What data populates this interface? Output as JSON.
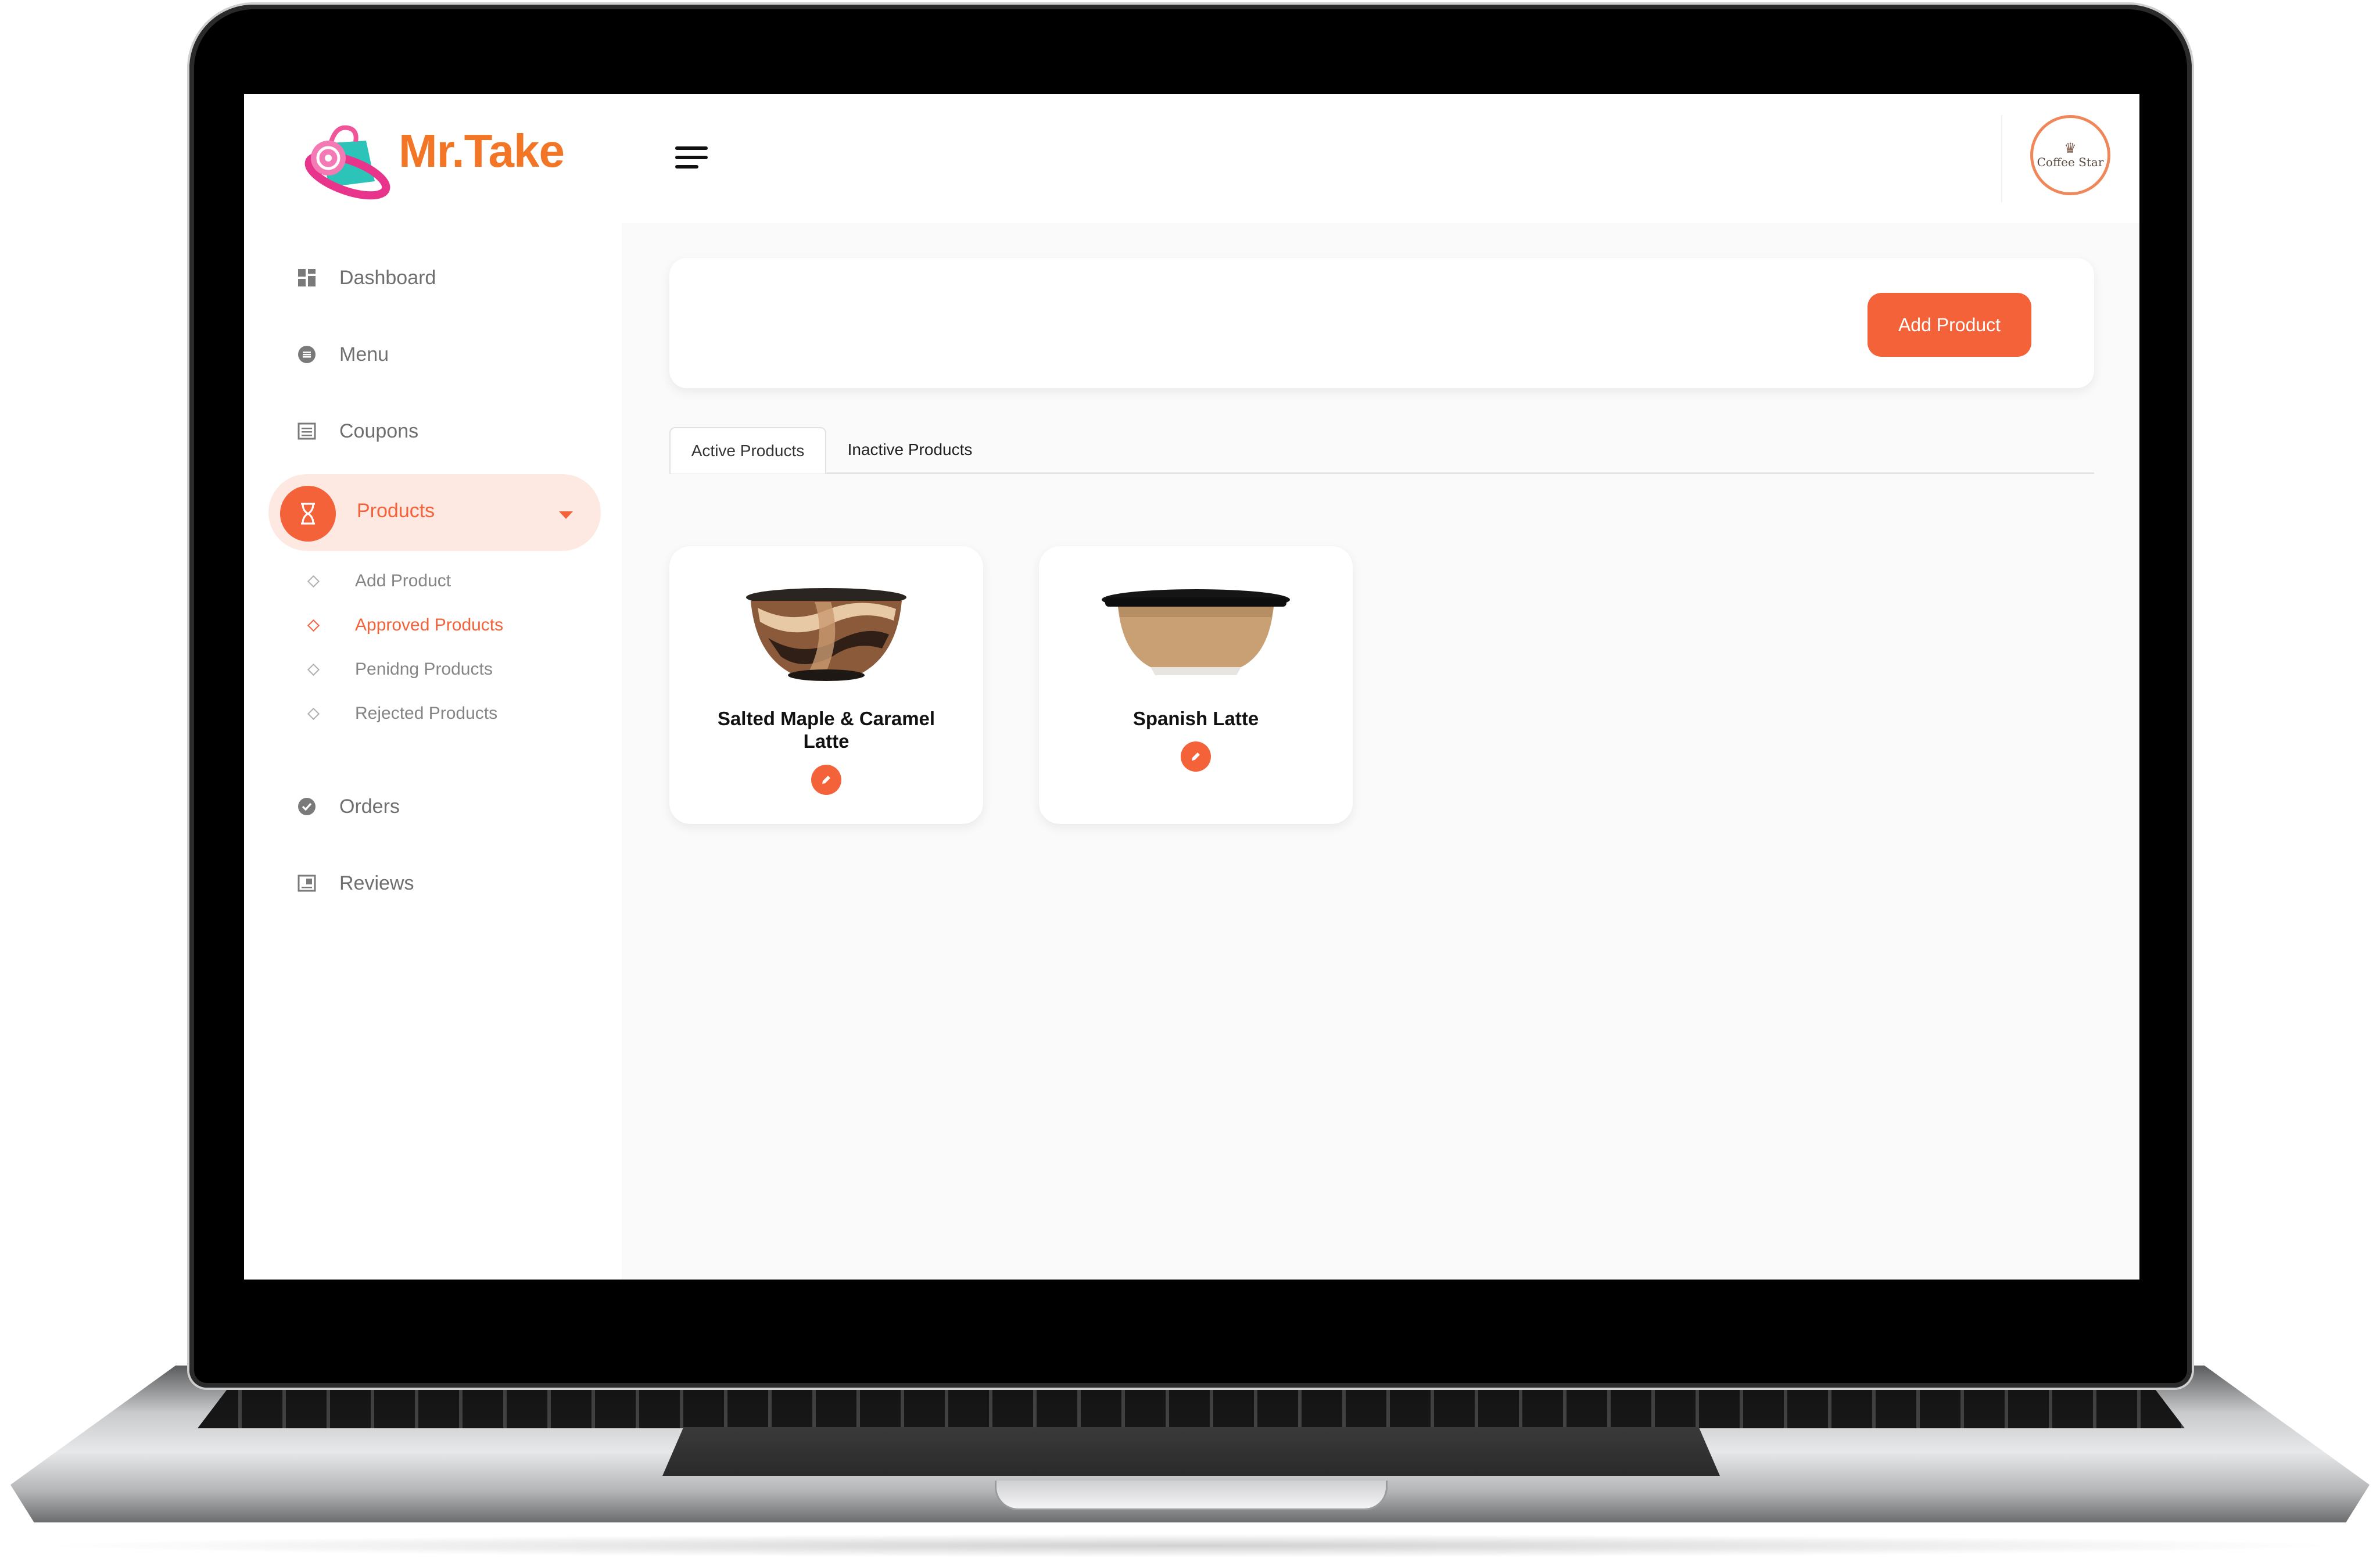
{
  "brand": {
    "name": "Mr.Take"
  },
  "sidebar": {
    "items": [
      {
        "label": "Dashboard",
        "icon": "dashboard-icon"
      },
      {
        "label": "Menu",
        "icon": "menu-circle-icon"
      },
      {
        "label": "Coupons",
        "icon": "coupon-icon"
      },
      {
        "label": "Products",
        "icon": "hourglass-icon",
        "active": true
      },
      {
        "label": "Orders",
        "icon": "check-circle-icon"
      },
      {
        "label": "Reviews",
        "icon": "review-icon"
      }
    ],
    "products_submenu": [
      {
        "label": "Add Product"
      },
      {
        "label": "Approved Products",
        "active": true
      },
      {
        "label": "Penidng Products"
      },
      {
        "label": "Rejected Products"
      }
    ]
  },
  "header": {
    "avatar_text": "Coffee Star",
    "avatar_icon": "crown-icon"
  },
  "actions": {
    "add_product_label": "Add Product"
  },
  "tabs": [
    {
      "label": "Active Products",
      "active": true
    },
    {
      "label": "Inactive Products",
      "active": false
    }
  ],
  "products": [
    {
      "name": "Salted Maple & Caramel Latte",
      "image": "patterned-cup-icon"
    },
    {
      "name": "Spanish Latte",
      "image": "kraft-cup-icon"
    }
  ],
  "colors": {
    "accent": "#f4623a",
    "brand": "#f37626",
    "active_bg": "#fde9e2"
  }
}
